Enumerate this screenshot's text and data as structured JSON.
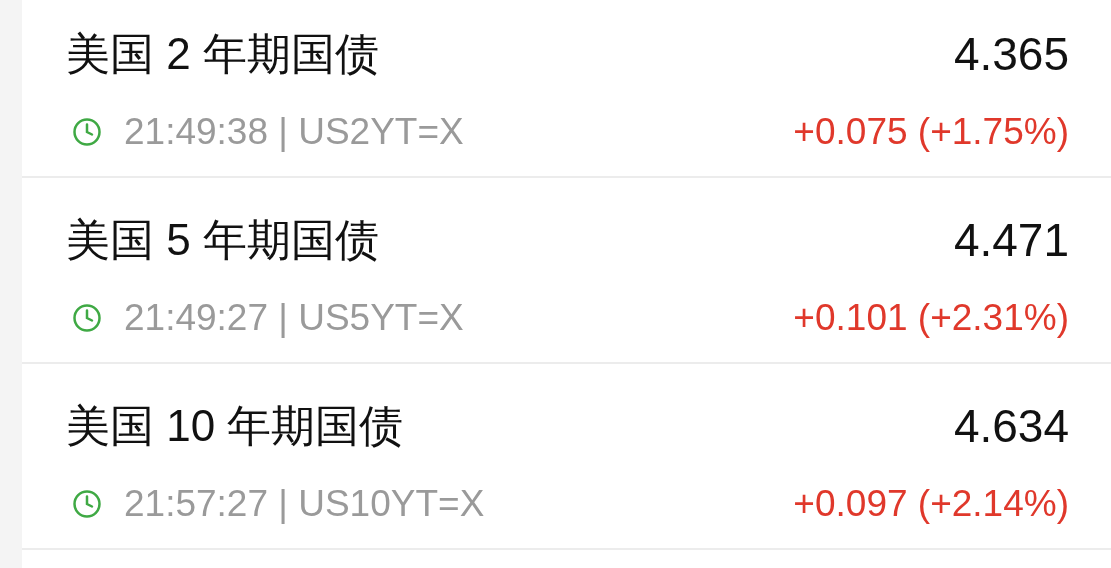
{
  "bonds": [
    {
      "name": "美国 2 年期国债",
      "price": "4.365",
      "meta": "21:49:38 | US2YT=X",
      "change": "+0.075 (+1.75%)"
    },
    {
      "name": "美国 5 年期国债",
      "price": "4.471",
      "meta": "21:49:27 | US5YT=X",
      "change": "+0.101 (+2.31%)"
    },
    {
      "name": "美国 10 年期国债",
      "price": "4.634",
      "meta": "21:57:27 | US10YT=X",
      "change": "+0.097 (+2.14%)"
    }
  ]
}
